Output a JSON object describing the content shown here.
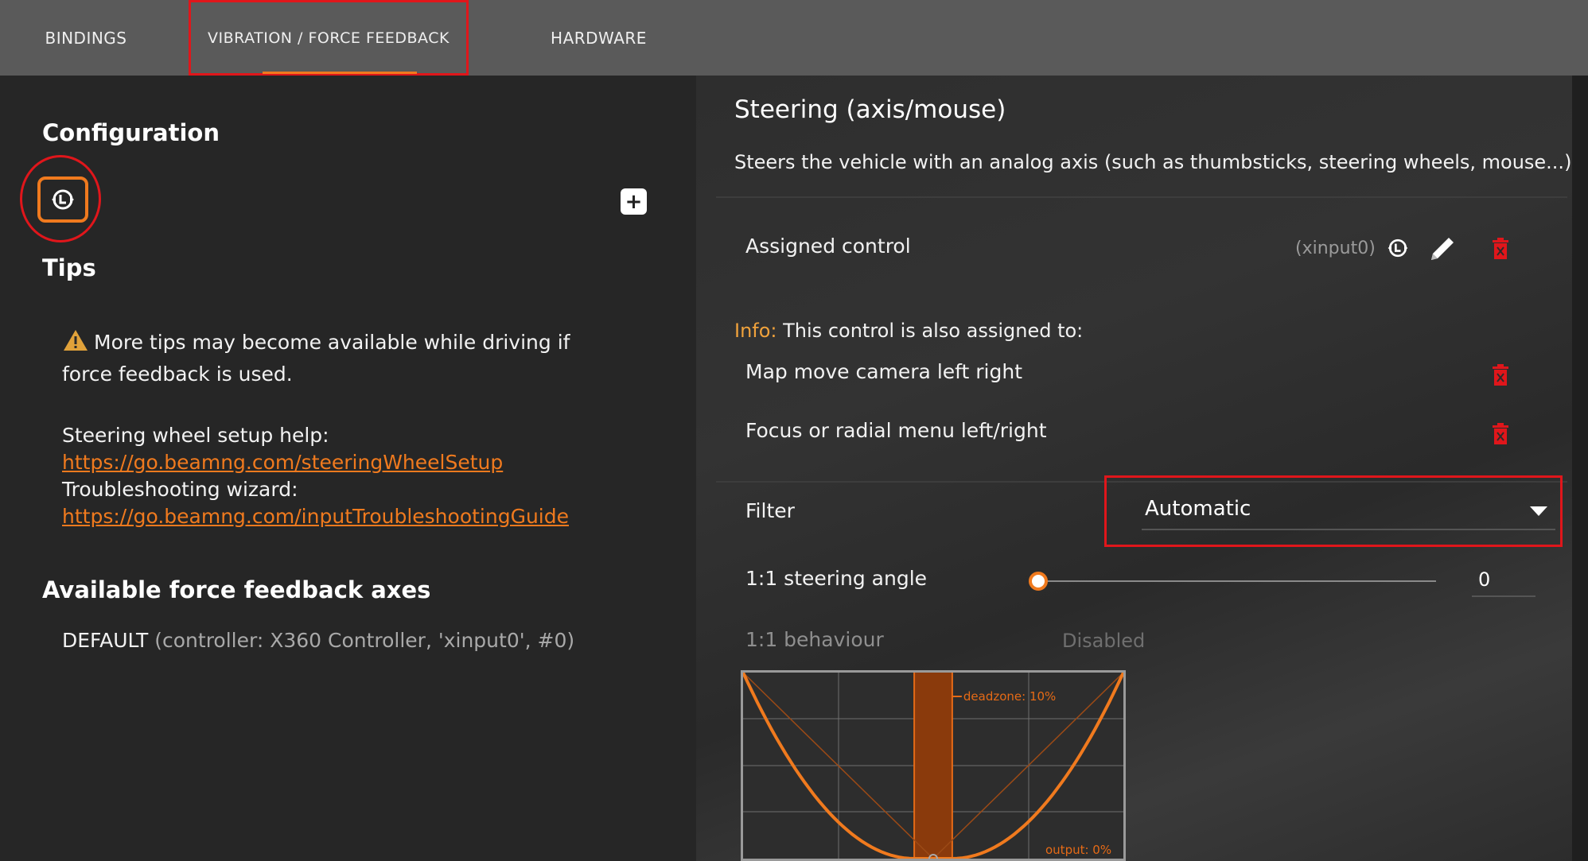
{
  "tabs": [
    {
      "label": "BINDINGS",
      "active": false
    },
    {
      "label": "VIBRATION / FORCE FEEDBACK",
      "active": true
    },
    {
      "label": "HARDWARE",
      "active": false
    }
  ],
  "left": {
    "configuration_title": "Configuration",
    "tips_title": "Tips",
    "tip_warning": "More tips may become available while driving if force feedback is used.",
    "steering_help_label": "Steering wheel setup help:",
    "steering_help_link": "https://go.beamng.com/steeringWheelSetup",
    "troubleshooting_label": "Troubleshooting wizard:",
    "troubleshooting_link": "https://go.beamng.com/inputTroubleshootingGuide",
    "ffb_axes_title": "Available force feedback axes",
    "ffb_axis_name": "DEFAULT",
    "ffb_axis_detail": "(controller: X360 Controller, 'xinput0', #0)"
  },
  "right": {
    "title": "Steering (axis/mouse)",
    "description": "Steers the vehicle with an analog axis (such as thumbsticks, steering wheels, mouse...)",
    "assigned_label": "Assigned control",
    "assigned_device": "(xinput0)",
    "info_prefix": "Info:",
    "info_text": " This control is also assigned to:",
    "also_assigned": [
      "Map move camera left right",
      "Focus or radial menu left/right"
    ],
    "filter_label": "Filter",
    "filter_value": "Automatic",
    "steering_angle_label": "1:1 steering angle",
    "steering_angle_value": "0",
    "behaviour_label": "1:1 behaviour",
    "behaviour_value": "Disabled",
    "graph_deadzone_label": "deadzone: 10%",
    "graph_output_label": "output: 0%",
    "graph_deadzone_fraction": 0.1
  },
  "colors": {
    "accent": "#f07a1e",
    "highlight": "#e0161b",
    "delete": "#e0161b"
  }
}
